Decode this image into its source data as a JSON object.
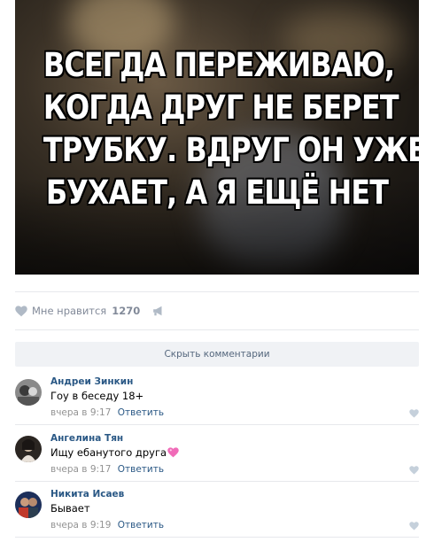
{
  "post": {
    "image_caption_lines": [
      "ВСЕГДА ПЕРЕЖИВАЮ,",
      "КОГДА ДРУГ НЕ БЕРЕТ",
      "ТРУБКУ. ВДРУГ ОН УЖЕ",
      "БУХАЕТ, А Я ЕЩЁ НЕТ"
    ]
  },
  "likes": {
    "label": "Мне нравится",
    "count": "1270",
    "heart_icon": "heart-icon",
    "share_icon": "megaphone-icon"
  },
  "comments_toggle": {
    "label": "Скрыть комментарии"
  },
  "comments": [
    {
      "author": "Андреи Зинкин",
      "text": "Гоу в беседу 18+",
      "time": "вчера в 9:17",
      "reply": "Ответить"
    },
    {
      "author": "Ангелина Тян",
      "text": "Ищу ебанутого друга",
      "time": "вчера в 9:17",
      "reply": "Ответить"
    },
    {
      "author": "Никита Исаев",
      "text": "Бывает",
      "time": "вчера в 9:19",
      "reply": "Ответить"
    }
  ],
  "colors": {
    "link": "#2a5885",
    "meta": "#939393",
    "likes_text": "#828a99",
    "button_bg": "#f0f2f5",
    "divider": "#e7e8ec"
  }
}
